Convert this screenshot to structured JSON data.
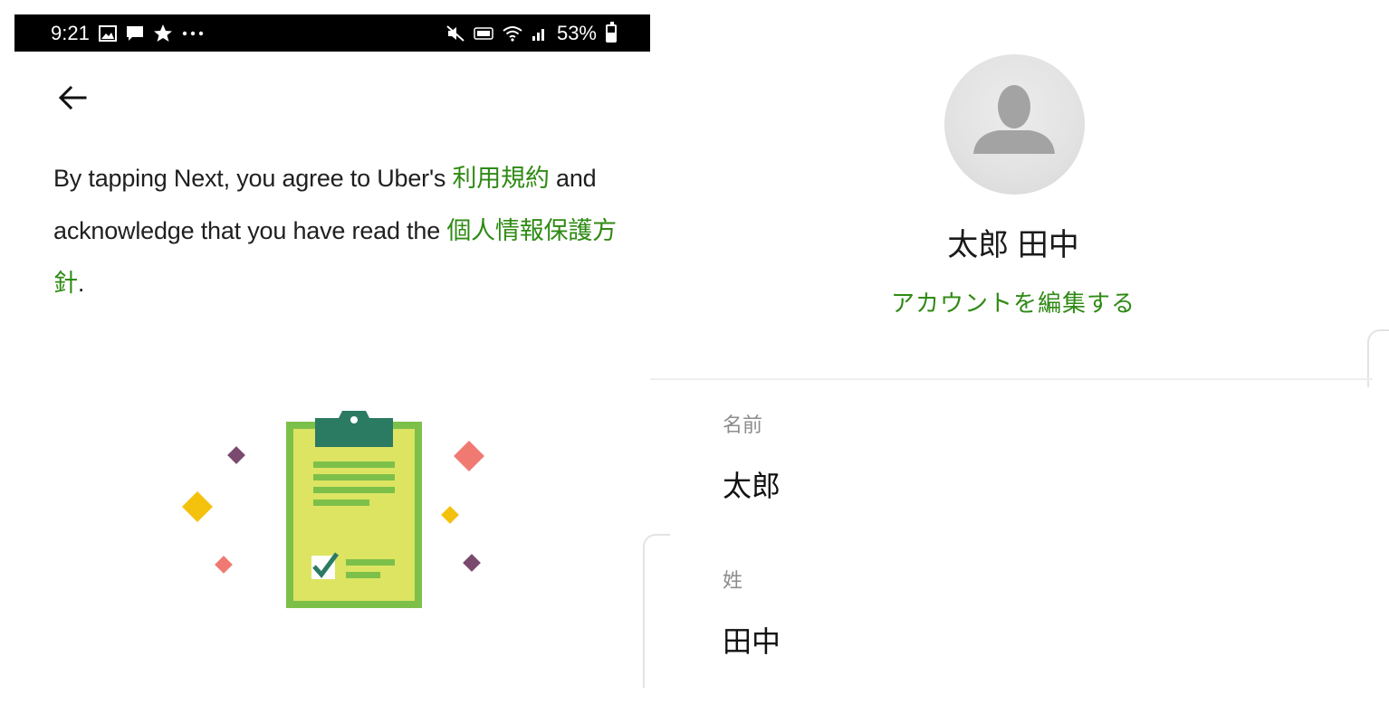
{
  "status_bar": {
    "time": "9:21",
    "battery": "53%",
    "left_icons": [
      "gallery-icon",
      "message-icon",
      "star-icon",
      "more-icon"
    ],
    "right_icons": [
      "mute-icon",
      "volte-icon",
      "wifi-icon",
      "signal-icon",
      "battery-icon"
    ]
  },
  "terms": {
    "part1": "By tapping Next, you agree to Uber's ",
    "terms_link": "利用規約",
    "part2": " and acknowledge that you have read the ",
    "privacy_link": "個人情報保護方針",
    "part3": "."
  },
  "profile": {
    "name": "太郎 田中",
    "edit_link": "アカウントを編集する"
  },
  "fields": {
    "first_name_label": "名前",
    "first_name_value": "太郎",
    "last_name_label": "姓",
    "last_name_value": "田中"
  },
  "colors": {
    "link": "#2f8a14",
    "clipboard_fill": "#dce462",
    "clipboard_border": "#7cc04a",
    "clipboard_clip": "#2b7a62"
  }
}
